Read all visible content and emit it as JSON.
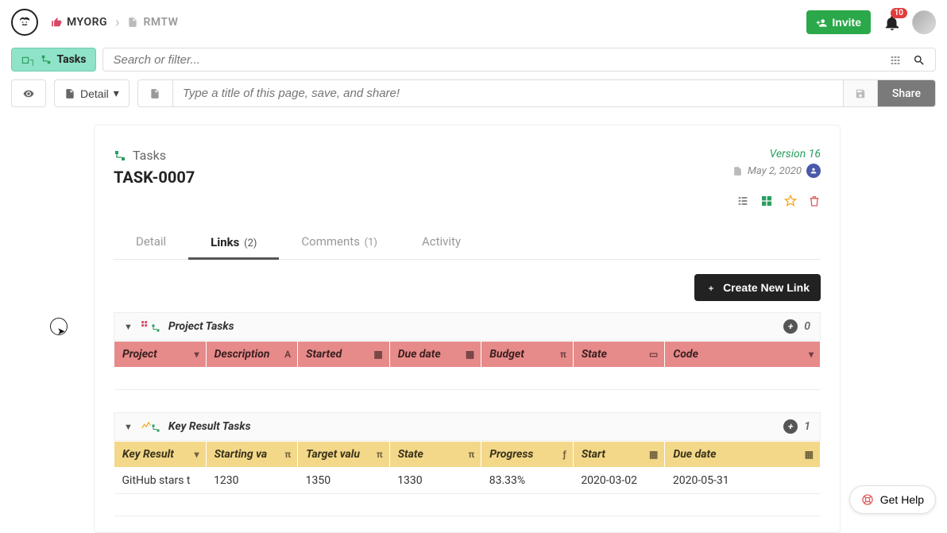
{
  "breadcrumb": {
    "org": "MYORG",
    "page": "RMTW"
  },
  "invite_label": "Invite",
  "notif_count": "10",
  "tasks_pill": "Tasks",
  "search_placeholder": "Search or filter...",
  "detail_btn": "Detail",
  "title_placeholder": "Type a title of this page, save, and share!",
  "share_label": "Share",
  "card": {
    "kind": "Tasks",
    "task_id": "TASK-0007",
    "version": "Version 16",
    "date": "May 2, 2020"
  },
  "tabs": {
    "detail": "Detail",
    "links": "Links",
    "links_count": "(2)",
    "comments": "Comments",
    "comments_count": "(1)",
    "activity": "Activity"
  },
  "create_link_label": "Create New Link",
  "sections": {
    "project": {
      "title": "Project Tasks",
      "count": "0",
      "columns": [
        "Project",
        "Description",
        "Started",
        "Due date",
        "Budget",
        "State",
        "Code"
      ]
    },
    "keyresult": {
      "title": "Key Result Tasks",
      "count": "1",
      "columns": [
        "Key Result",
        "Starting va",
        "Target valu",
        "State",
        "Progress",
        "Start",
        "Due date"
      ],
      "rows": [
        {
          "kr": "GitHub stars t",
          "start_val": "1230",
          "target_val": "1350",
          "state": "1330",
          "progress": "83.33%",
          "start": "2020-03-02",
          "due": "2020-05-31"
        }
      ]
    }
  },
  "help_label": "Get Help"
}
